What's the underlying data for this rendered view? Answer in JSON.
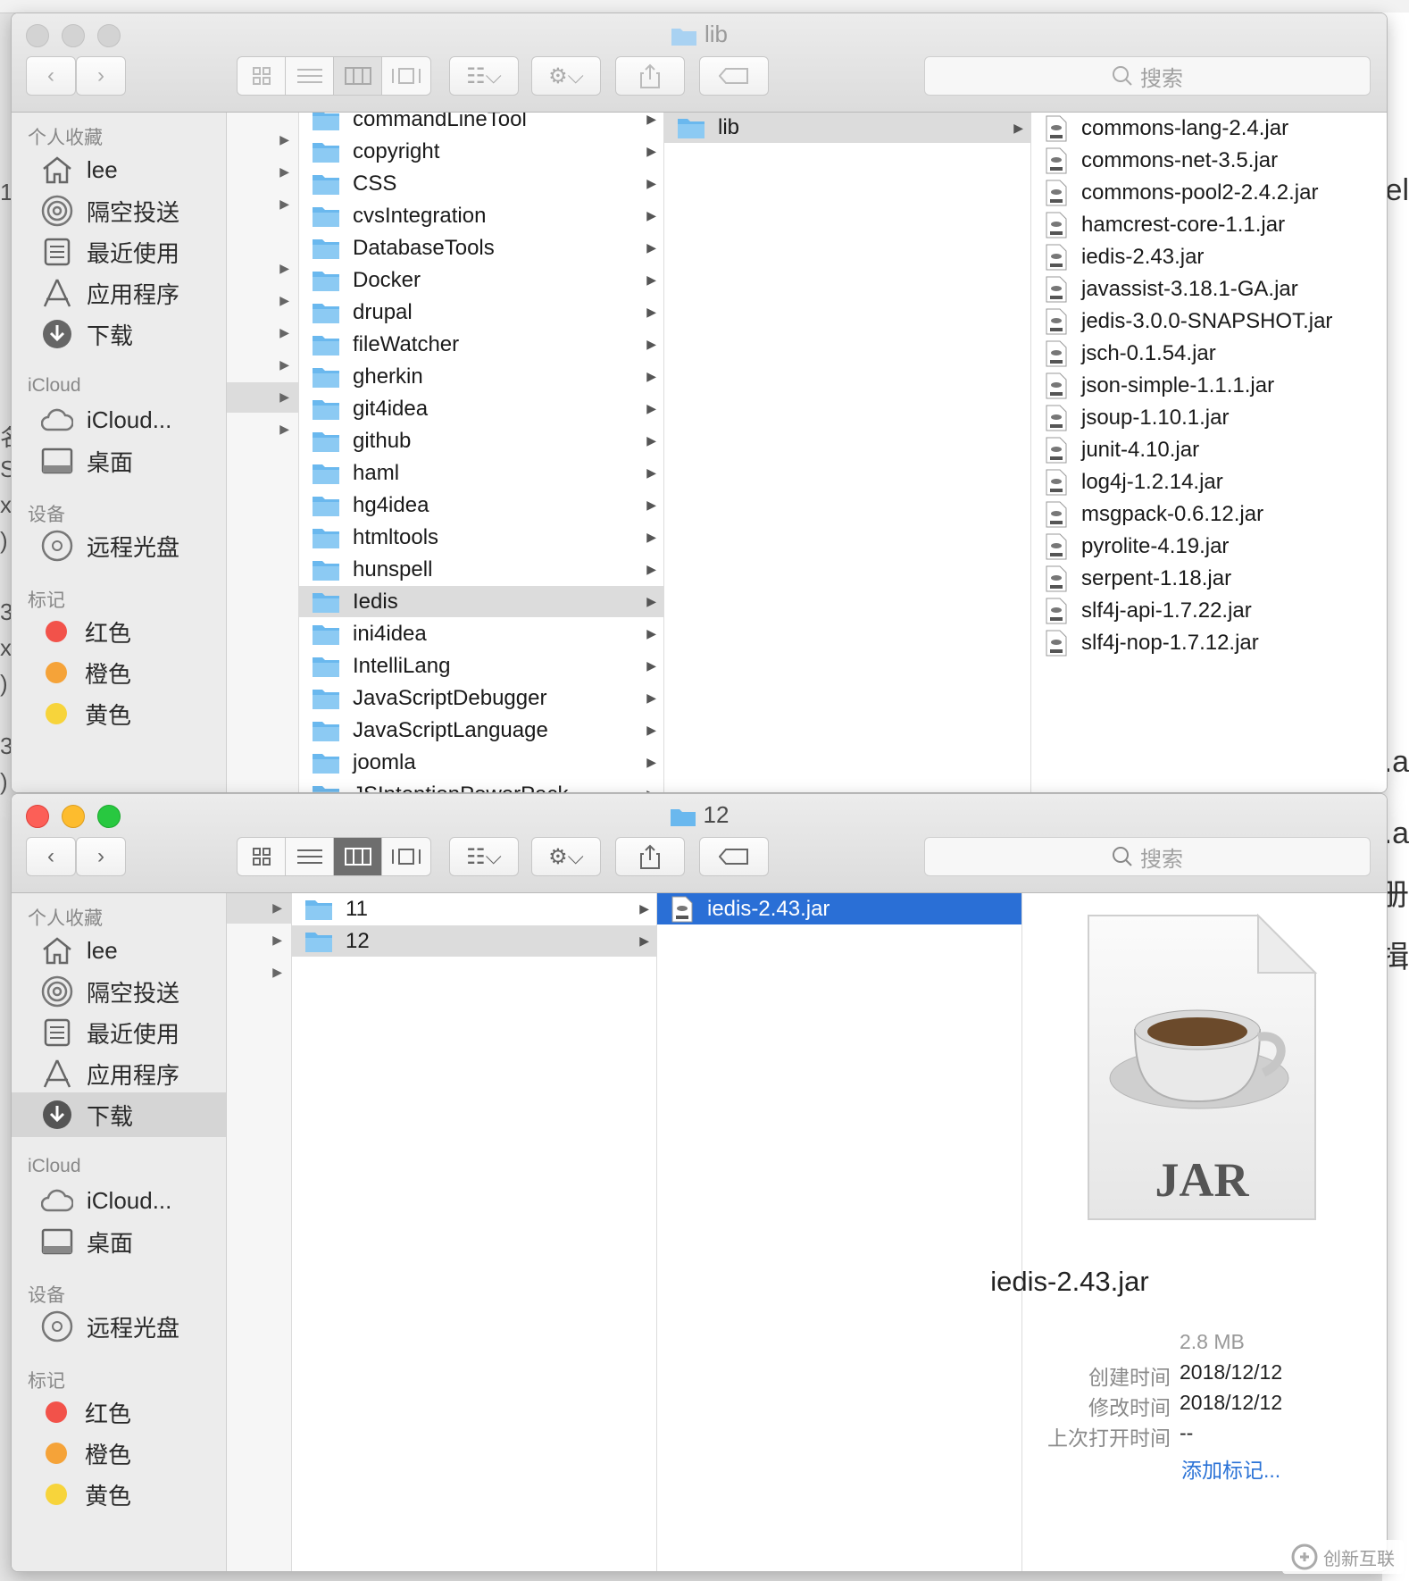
{
  "background": {
    "right_fragments": [
      "el",
      ".a",
      ".a",
      "册",
      "揖"
    ],
    "left_fragments": [
      "1",
      "名",
      "S/",
      "x",
      ")",
      "3/",
      "x",
      ")",
      "3/",
      ")"
    ]
  },
  "top_window": {
    "title": "lib",
    "search_placeholder": "搜索",
    "sidebar": {
      "favorites_header": "个人收藏",
      "favorites": [
        {
          "label": "lee",
          "icon": "home-icon"
        },
        {
          "label": "隔空投送",
          "icon": "airdrop-icon"
        },
        {
          "label": "最近使用",
          "icon": "recents-icon"
        },
        {
          "label": "应用程序",
          "icon": "applications-icon"
        },
        {
          "label": "下载",
          "icon": "downloads-icon"
        }
      ],
      "icloud_header": "iCloud",
      "icloud": [
        {
          "label": "iCloud...",
          "icon": "cloud-icon"
        },
        {
          "label": "桌面",
          "icon": "desktop-icon"
        }
      ],
      "devices_header": "设备",
      "devices": [
        {
          "label": "远程光盘",
          "icon": "disc-icon"
        }
      ],
      "tags_header": "标记",
      "tags": [
        {
          "label": "红色",
          "color": "#f2524a"
        },
        {
          "label": "橙色",
          "color": "#f5a339"
        },
        {
          "label": "黄色",
          "color": "#f7d43b"
        }
      ]
    },
    "folders": [
      "commandLineTool",
      "copyright",
      "CSS",
      "cvsIntegration",
      "DatabaseTools",
      "Docker",
      "drupal",
      "fileWatcher",
      "gherkin",
      "git4idea",
      "github",
      "haml",
      "hg4idea",
      "htmltools",
      "hunspell",
      "Iedis",
      "ini4idea",
      "IntelliLang",
      "JavaScriptDebugger",
      "JavaScriptLanguage",
      "joomla",
      "JSIntentionPowerPack"
    ],
    "selected_folder": "Iedis",
    "subfolder": "lib",
    "jars": [
      "commons-lang-2.4.jar",
      "commons-net-3.5.jar",
      "commons-pool2-2.4.2.jar",
      "hamcrest-core-1.1.jar",
      "iedis-2.43.jar",
      "javassist-3.18.1-GA.jar",
      "jedis-3.0.0-SNAPSHOT.jar",
      "jsch-0.1.54.jar",
      "json-simple-1.1.1.jar",
      "jsoup-1.10.1.jar",
      "junit-4.10.jar",
      "log4j-1.2.14.jar",
      "msgpack-0.6.12.jar",
      "pyrolite-4.19.jar",
      "serpent-1.18.jar",
      "slf4j-api-1.7.22.jar",
      "slf4j-nop-1.7.12.jar"
    ]
  },
  "bottom_window": {
    "title": "12",
    "search_placeholder": "搜索",
    "sidebar": {
      "favorites_header": "个人收藏",
      "favorites": [
        {
          "label": "lee",
          "icon": "home-icon"
        },
        {
          "label": "隔空投送",
          "icon": "airdrop-icon"
        },
        {
          "label": "最近使用",
          "icon": "recents-icon"
        },
        {
          "label": "应用程序",
          "icon": "applications-icon"
        },
        {
          "label": "下载",
          "icon": "downloads-icon"
        }
      ],
      "icloud_header": "iCloud",
      "icloud": [
        {
          "label": "iCloud...",
          "icon": "cloud-icon"
        },
        {
          "label": "桌面",
          "icon": "desktop-icon"
        }
      ],
      "devices_header": "设备",
      "devices": [
        {
          "label": "远程光盘",
          "icon": "disc-icon"
        }
      ],
      "tags_header": "标记",
      "tags": [
        {
          "label": "红色",
          "color": "#f2524a"
        },
        {
          "label": "橙色",
          "color": "#f5a339"
        },
        {
          "label": "黄色",
          "color": "#f7d43b"
        }
      ],
      "selected": "下载"
    },
    "folders": [
      "11",
      "12"
    ],
    "selected_folder": "12",
    "selected_file": "iedis-2.43.jar",
    "preview": {
      "icon_text": "JAR",
      "name": "iedis-2.43.jar",
      "size": "2.8 MB",
      "created_label": "创建时间",
      "created": "2018/12/12",
      "modified_label": "修改时间",
      "modified": "2018/12/12",
      "opened_label": "上次打开时间",
      "opened": "--",
      "add_tags": "添加标记..."
    }
  },
  "watermark": "创新互联",
  "colors": {
    "selection_blue": "#2a6fd6",
    "folder_blue": "#6ab8ee",
    "link_blue": "#2a72d6"
  }
}
